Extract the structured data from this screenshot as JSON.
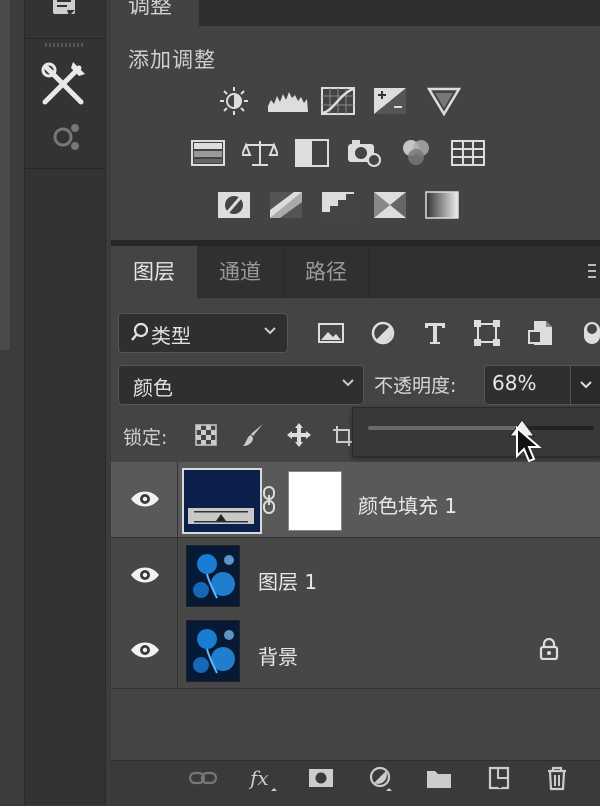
{
  "adjustments": {
    "tab_label": "调整",
    "title": "添加调整",
    "icons": [
      [
        "brightness-contrast-icon",
        "levels-icon",
        "curves-icon",
        "exposure-icon",
        "vibrance-icon"
      ],
      [
        "hue-saturation-icon",
        "color-balance-icon",
        "black-white-icon",
        "photo-filter-icon",
        "channel-mixer-icon",
        "color-lookup-icon"
      ],
      [
        "invert-icon",
        "posterize-icon",
        "threshold-icon",
        "selective-color-icon",
        "gradient-map-icon"
      ]
    ]
  },
  "layers_panel": {
    "tabs": [
      {
        "label": "图层",
        "active": true
      },
      {
        "label": "通道",
        "active": false
      },
      {
        "label": "路径",
        "active": false
      }
    ],
    "filter": {
      "icon": "search-icon",
      "value": "类型"
    },
    "blend_mode": "颜色",
    "opacity": {
      "label": "不透明度:",
      "value": "68%",
      "level": 0.68
    },
    "lock_label": "锁定:",
    "layers": [
      {
        "name": "颜色填充 1",
        "visible": true,
        "selected": true,
        "thumb_color": "#0b1f4a"
      },
      {
        "name": "图层 1",
        "visible": true,
        "selected": false
      },
      {
        "name": "背景",
        "visible": true,
        "selected": false,
        "locked": true
      }
    ]
  },
  "colors": {
    "panel_bg": "#444444",
    "selected_row": "#595959",
    "fill_color": "#0b1f4a",
    "photo_blue": "#1e8ff0"
  }
}
